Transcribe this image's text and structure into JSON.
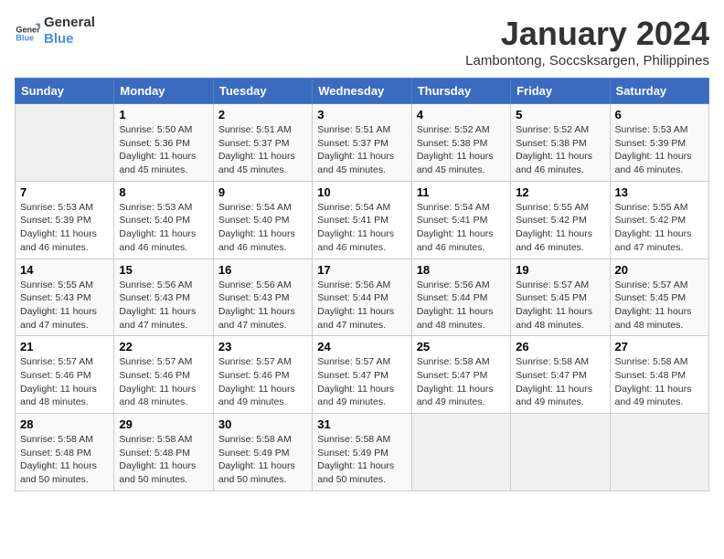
{
  "logo": {
    "line1": "General",
    "line2": "Blue"
  },
  "title": "January 2024",
  "subtitle": "Lambontong, Soccsksargen, Philippines",
  "days_of_week": [
    "Sunday",
    "Monday",
    "Tuesday",
    "Wednesday",
    "Thursday",
    "Friday",
    "Saturday"
  ],
  "weeks": [
    [
      {
        "day": null
      },
      {
        "day": "1",
        "sunrise": "5:50 AM",
        "sunset": "5:36 PM",
        "daylight": "11 hours and 45 minutes."
      },
      {
        "day": "2",
        "sunrise": "5:51 AM",
        "sunset": "5:37 PM",
        "daylight": "11 hours and 45 minutes."
      },
      {
        "day": "3",
        "sunrise": "5:51 AM",
        "sunset": "5:37 PM",
        "daylight": "11 hours and 45 minutes."
      },
      {
        "day": "4",
        "sunrise": "5:52 AM",
        "sunset": "5:38 PM",
        "daylight": "11 hours and 45 minutes."
      },
      {
        "day": "5",
        "sunrise": "5:52 AM",
        "sunset": "5:38 PM",
        "daylight": "11 hours and 46 minutes."
      },
      {
        "day": "6",
        "sunrise": "5:53 AM",
        "sunset": "5:39 PM",
        "daylight": "11 hours and 46 minutes."
      }
    ],
    [
      {
        "day": "7",
        "sunrise": "5:53 AM",
        "sunset": "5:39 PM",
        "daylight": "11 hours and 46 minutes."
      },
      {
        "day": "8",
        "sunrise": "5:53 AM",
        "sunset": "5:40 PM",
        "daylight": "11 hours and 46 minutes."
      },
      {
        "day": "9",
        "sunrise": "5:54 AM",
        "sunset": "5:40 PM",
        "daylight": "11 hours and 46 minutes."
      },
      {
        "day": "10",
        "sunrise": "5:54 AM",
        "sunset": "5:41 PM",
        "daylight": "11 hours and 46 minutes."
      },
      {
        "day": "11",
        "sunrise": "5:54 AM",
        "sunset": "5:41 PM",
        "daylight": "11 hours and 46 minutes."
      },
      {
        "day": "12",
        "sunrise": "5:55 AM",
        "sunset": "5:42 PM",
        "daylight": "11 hours and 46 minutes."
      },
      {
        "day": "13",
        "sunrise": "5:55 AM",
        "sunset": "5:42 PM",
        "daylight": "11 hours and 47 minutes."
      }
    ],
    [
      {
        "day": "14",
        "sunrise": "5:55 AM",
        "sunset": "5:43 PM",
        "daylight": "11 hours and 47 minutes."
      },
      {
        "day": "15",
        "sunrise": "5:56 AM",
        "sunset": "5:43 PM",
        "daylight": "11 hours and 47 minutes."
      },
      {
        "day": "16",
        "sunrise": "5:56 AM",
        "sunset": "5:43 PM",
        "daylight": "11 hours and 47 minutes."
      },
      {
        "day": "17",
        "sunrise": "5:56 AM",
        "sunset": "5:44 PM",
        "daylight": "11 hours and 47 minutes."
      },
      {
        "day": "18",
        "sunrise": "5:56 AM",
        "sunset": "5:44 PM",
        "daylight": "11 hours and 48 minutes."
      },
      {
        "day": "19",
        "sunrise": "5:57 AM",
        "sunset": "5:45 PM",
        "daylight": "11 hours and 48 minutes."
      },
      {
        "day": "20",
        "sunrise": "5:57 AM",
        "sunset": "5:45 PM",
        "daylight": "11 hours and 48 minutes."
      }
    ],
    [
      {
        "day": "21",
        "sunrise": "5:57 AM",
        "sunset": "5:46 PM",
        "daylight": "11 hours and 48 minutes."
      },
      {
        "day": "22",
        "sunrise": "5:57 AM",
        "sunset": "5:46 PM",
        "daylight": "11 hours and 48 minutes."
      },
      {
        "day": "23",
        "sunrise": "5:57 AM",
        "sunset": "5:46 PM",
        "daylight": "11 hours and 49 minutes."
      },
      {
        "day": "24",
        "sunrise": "5:57 AM",
        "sunset": "5:47 PM",
        "daylight": "11 hours and 49 minutes."
      },
      {
        "day": "25",
        "sunrise": "5:58 AM",
        "sunset": "5:47 PM",
        "daylight": "11 hours and 49 minutes."
      },
      {
        "day": "26",
        "sunrise": "5:58 AM",
        "sunset": "5:47 PM",
        "daylight": "11 hours and 49 minutes."
      },
      {
        "day": "27",
        "sunrise": "5:58 AM",
        "sunset": "5:48 PM",
        "daylight": "11 hours and 49 minutes."
      }
    ],
    [
      {
        "day": "28",
        "sunrise": "5:58 AM",
        "sunset": "5:48 PM",
        "daylight": "11 hours and 50 minutes."
      },
      {
        "day": "29",
        "sunrise": "5:58 AM",
        "sunset": "5:48 PM",
        "daylight": "11 hours and 50 minutes."
      },
      {
        "day": "30",
        "sunrise": "5:58 AM",
        "sunset": "5:49 PM",
        "daylight": "11 hours and 50 minutes."
      },
      {
        "day": "31",
        "sunrise": "5:58 AM",
        "sunset": "5:49 PM",
        "daylight": "11 hours and 50 minutes."
      },
      {
        "day": null
      },
      {
        "day": null
      },
      {
        "day": null
      }
    ]
  ]
}
